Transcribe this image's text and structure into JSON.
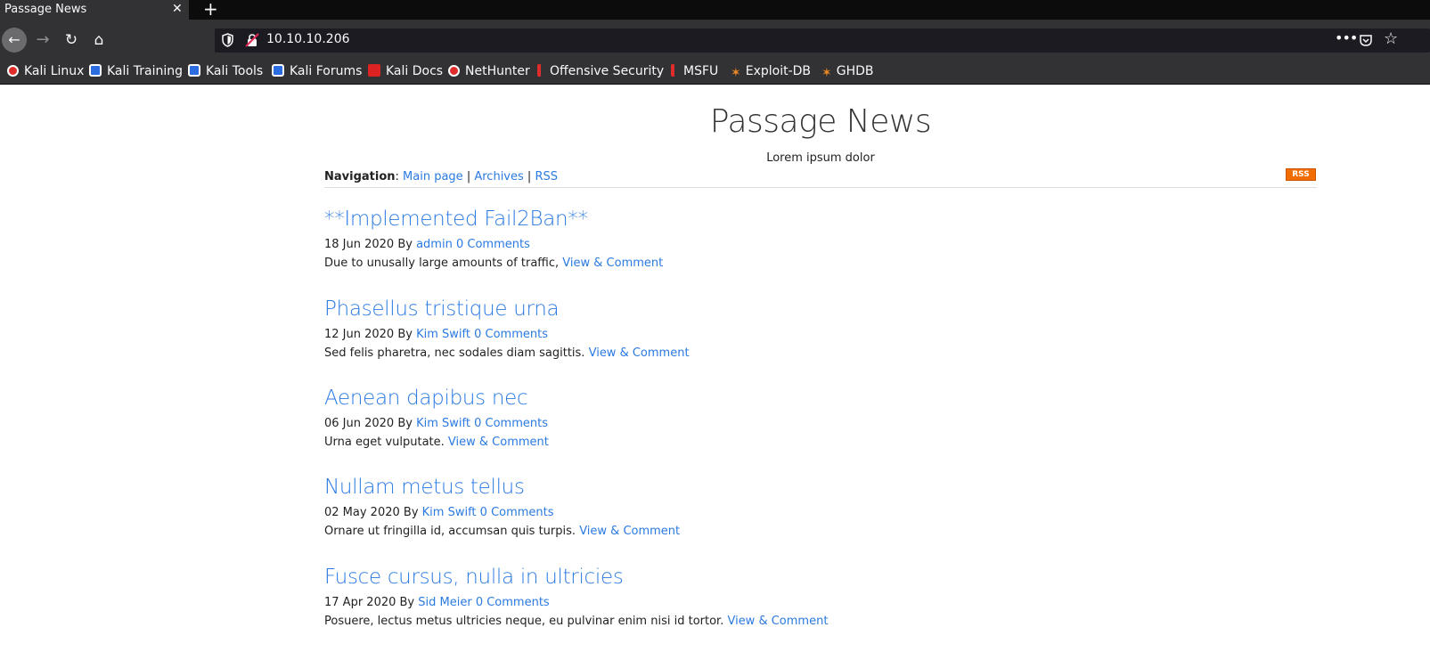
{
  "browser": {
    "tab_title": "Passage News",
    "tab_close": "✕",
    "new_tab": "+",
    "url": "10.10.10.206",
    "bookmarks": [
      "Kali Linux",
      "Kali Training",
      "Kali Tools",
      "Kali Forums",
      "Kali Docs",
      "NetHunter",
      "Offensive Security",
      "MSFU",
      "Exploit-DB",
      "GHDB"
    ]
  },
  "site": {
    "title": "Passage News",
    "subtitle": "Lorem ipsum dolor",
    "nav_label": "Navigation",
    "nav_links": [
      "Main page",
      "Archives",
      "RSS"
    ],
    "rss_badge": "RSS"
  },
  "posts": [
    {
      "title": "**Implemented Fail2Ban**",
      "date": "18 Jun 2020 By",
      "author": "admin",
      "comments": "0 Comments",
      "excerpt": "Due to unusally large amounts of traffic,",
      "link": "View & Comment"
    },
    {
      "title": "Phasellus tristique urna",
      "date": "12 Jun 2020 By",
      "author": "Kim Swift",
      "comments": "0 Comments",
      "excerpt": "Sed felis pharetra, nec sodales diam sagittis.",
      "link": "View & Comment"
    },
    {
      "title": "Aenean dapibus nec",
      "date": "06 Jun 2020 By",
      "author": "Kim Swift",
      "comments": "0 Comments",
      "excerpt": "Urna eget vulputate.",
      "link": "View & Comment"
    },
    {
      "title": "Nullam metus tellus",
      "date": "02 May 2020 By",
      "author": "Kim Swift",
      "comments": "0 Comments",
      "excerpt": "Ornare ut fringilla id, accumsan quis turpis.",
      "link": "View & Comment"
    },
    {
      "title": "Fusce cursus, nulla in ultricies",
      "date": "17 Apr 2020 By",
      "author": "Sid Meier",
      "comments": "0 Comments",
      "excerpt": "Posuere, lectus metus ultricies neque, eu pulvinar enim nisi id tortor.",
      "link": "View & Comment"
    }
  ],
  "colors": {
    "link": "#2a7ae2",
    "chrome_dark": "#323234",
    "rss_orange": "#f26d00"
  }
}
